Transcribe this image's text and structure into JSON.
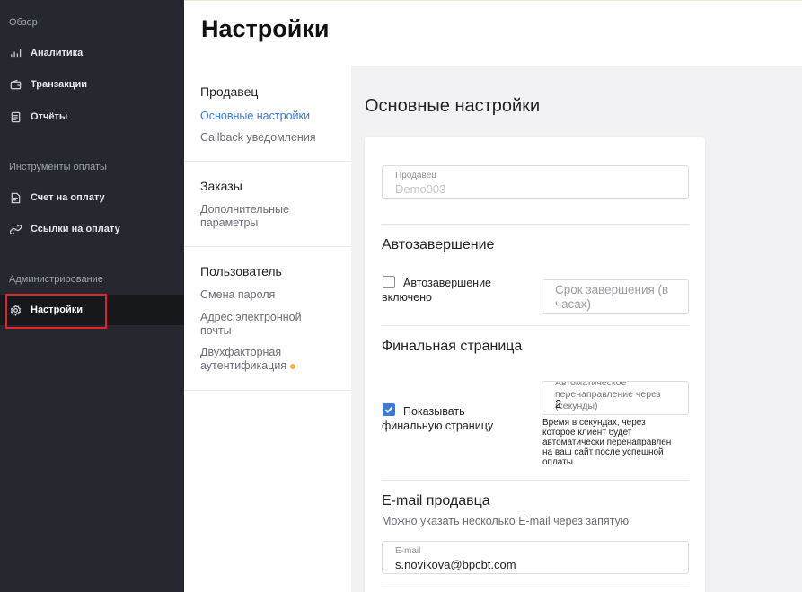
{
  "sidebar": {
    "sections": [
      {
        "label": "Обзор"
      },
      {
        "label": "Инструменты оплаты"
      },
      {
        "label": "Администрирование"
      }
    ],
    "items": [
      {
        "label": "Аналитика",
        "icon": "bar-chart-icon"
      },
      {
        "label": "Транзакции",
        "icon": "wallet-icon"
      },
      {
        "label": "Отчёты",
        "icon": "document-icon"
      },
      {
        "label": "Счет на оплату",
        "icon": "invoice-icon"
      },
      {
        "label": "Ссылки на оплату",
        "icon": "link-icon"
      },
      {
        "label": "Настройки",
        "icon": "gear-icon",
        "active": true
      }
    ]
  },
  "header": {
    "title": "Настройки"
  },
  "subnav": {
    "groups": [
      {
        "title": "Продавец",
        "links": [
          "Основные настройки",
          "Callback уведомления"
        ]
      },
      {
        "title": "Заказы",
        "links": [
          "Дополнительные параметры"
        ]
      },
      {
        "title": "Пользователь",
        "links": [
          "Смена пароля",
          "Адрес электронной почты",
          "Двухфакторная аутентификация"
        ]
      }
    ]
  },
  "main": {
    "title": "Основные настройки",
    "seller": {
      "label": "Продавец",
      "value": "Demo003"
    },
    "autocomplete": {
      "heading": "Автозавершение",
      "checkbox_label": "Автозавершение включено",
      "checked": false,
      "period_placeholder": "Срок завершения (в часах)"
    },
    "final_page": {
      "heading": "Финальная страница",
      "checkbox_label": "Показывать финальную страницу",
      "checked": true,
      "redirect_label": "Автоматическое перенаправление через (секунды)",
      "redirect_value": "2",
      "hint": "Время в секундах, через которое клиент будет автоматически перенаправлен на ваш сайт после успешной оплаты."
    },
    "email": {
      "heading": "E-mail продавца",
      "subtext": "Можно указать несколько E-mail через запятую",
      "label": "E-mail",
      "value": "s.novikova@bpcbt.com"
    }
  },
  "colors": {
    "accent": "#3a7bd5",
    "sidebar_bg": "#25282e",
    "highlight": "#e0242a",
    "dot": "#f0b43c"
  }
}
